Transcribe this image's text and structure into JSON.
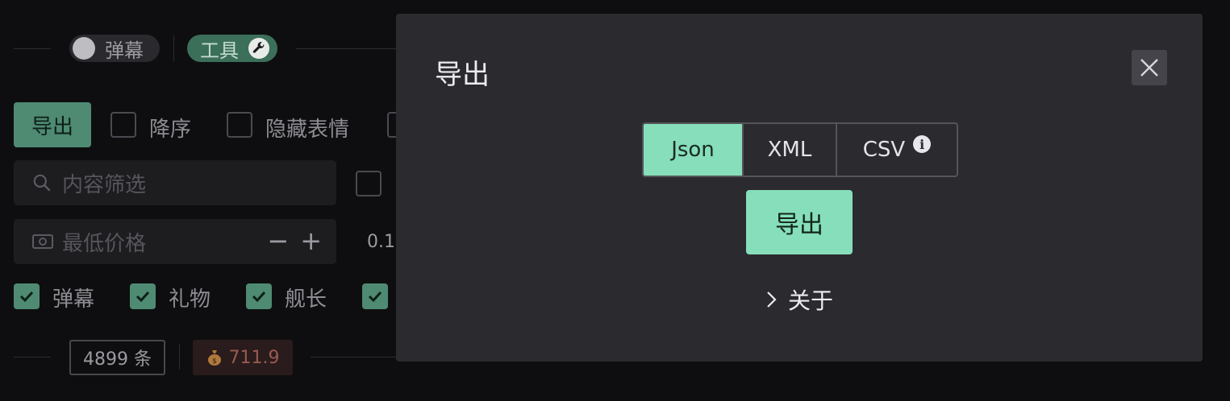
{
  "background": {
    "toggles": {
      "danmu_label": "弹幕",
      "tools_label": "工具"
    },
    "export_button": "导出",
    "options": [
      "降序",
      "隐藏表情"
    ],
    "filter_placeholder": "内容筛选",
    "price_placeholder": "最低价格",
    "price_value": "0.1",
    "stepper": {
      "minus": "−",
      "plus": "+"
    },
    "types": [
      "弹幕",
      "礼物",
      "舰长"
    ],
    "count_text": "4899 条",
    "money_text": "711.9"
  },
  "modal": {
    "title": "导出",
    "formats": [
      {
        "label": "Json",
        "active": true
      },
      {
        "label": "XML",
        "active": false
      },
      {
        "label": "CSV",
        "active": false
      }
    ],
    "export_button": "导出",
    "about_label": "关于"
  },
  "colors": {
    "accent": "#86dfba",
    "accent_dark": "#4f8a73",
    "modal_bg": "#2b2a2f",
    "page_bg": "#0e0e10"
  },
  "icons": [
    "wrench-icon",
    "search-icon",
    "money-icon",
    "check-icon",
    "moneybag-icon",
    "close-icon",
    "info-icon",
    "chevron-right-icon"
  ]
}
